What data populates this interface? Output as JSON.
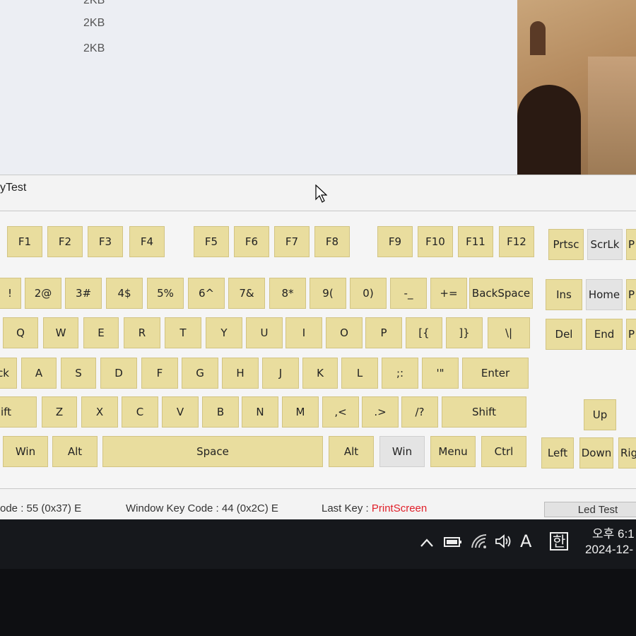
{
  "explorer": {
    "sizes": [
      "2KB",
      "2KB",
      "2KB"
    ]
  },
  "window": {
    "title": "yTest"
  },
  "keyboard": {
    "fn_row": [
      "F1",
      "F2",
      "F3",
      "F4",
      "F5",
      "F6",
      "F7",
      "F8",
      "F9",
      "F10",
      "F11",
      "F12"
    ],
    "sys_keys": [
      "Prtsc",
      "ScrLk",
      "P"
    ],
    "number_row": [
      "!",
      "2@",
      "3#",
      "4$",
      "5%",
      "6^",
      "7&",
      "8*",
      "9(",
      "0)",
      "-_",
      "+=",
      "BackSpace"
    ],
    "nav_keys": [
      "Ins",
      "Home",
      "P",
      "Del",
      "End",
      "P"
    ],
    "top_row": [
      "Q",
      "W",
      "E",
      "R",
      "T",
      "Y",
      "U",
      "I",
      "O",
      "P",
      "[{",
      "]}",
      "\\|"
    ],
    "home_row": [
      "ck",
      "A",
      "S",
      "D",
      "F",
      "G",
      "H",
      "J",
      "K",
      "L",
      ";:",
      "'\"",
      "Enter"
    ],
    "bottom_row": [
      "ift",
      "Z",
      "X",
      "C",
      "V",
      "B",
      "N",
      "M",
      ",<",
      ".>",
      "/?",
      "Shift"
    ],
    "space_row": [
      "Win",
      "Alt",
      "Space",
      "Alt",
      "Win",
      "Menu",
      "Ctrl"
    ],
    "arrows": [
      "Up",
      "Left",
      "Down",
      "Rig"
    ]
  },
  "status": {
    "code": "ode : 55 (0x37) E",
    "window_key_code": "Window Key Code : 44 (0x2C) E",
    "last_key_label": "Last Key :",
    "last_key_value": "PrintScreen",
    "led_button": "Led Test"
  },
  "taskbar": {
    "ime_label": "A",
    "ime_korean": "한",
    "clock_time": "오후 6:1",
    "clock_date": "2024-12-"
  },
  "colors": {
    "key": "#e9dd9e",
    "accent": "#e0202a",
    "taskbar": "#16181c"
  }
}
